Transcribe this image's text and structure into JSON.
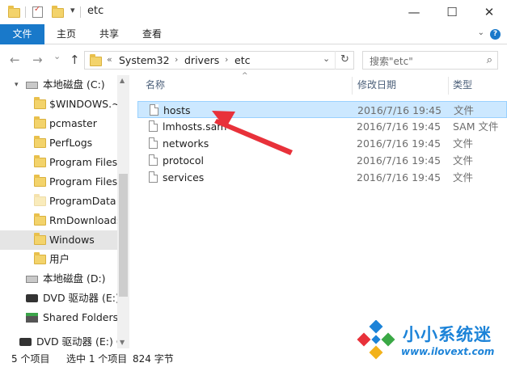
{
  "window": {
    "title": "etc",
    "minimize": "—",
    "maximize": "☐",
    "close": "✕",
    "qa_dropdown": "▾"
  },
  "ribbon": {
    "tabs": [
      "文件",
      "主页",
      "共享",
      "查看"
    ],
    "collapse": "⌄",
    "help": "?"
  },
  "nav_buttons": {
    "back": "←",
    "forward": "→",
    "recent": "⌄",
    "up": "↑"
  },
  "address": {
    "overflow": "«",
    "crumbs": [
      "System32",
      "drivers",
      "etc"
    ],
    "sep": "›",
    "dropdown": "⌄",
    "refresh": "↻"
  },
  "search": {
    "placeholder": "搜索\"etc\"",
    "icon": "⌕"
  },
  "nav_pane": {
    "items": [
      {
        "label": "本地磁盘 (C:)",
        "icon": "drive-icon",
        "kind": "drive"
      },
      {
        "label": "$WINDOWS.~",
        "icon": "folder-icon",
        "kind": "folder"
      },
      {
        "label": "pcmaster",
        "icon": "folder-icon",
        "kind": "folder"
      },
      {
        "label": "PerfLogs",
        "icon": "folder-icon",
        "kind": "folder"
      },
      {
        "label": "Program Files",
        "icon": "folder-icon",
        "kind": "folder"
      },
      {
        "label": "Program Files",
        "icon": "folder-icon",
        "kind": "folder"
      },
      {
        "label": "ProgramData",
        "icon": "folder-icon",
        "kind": "folder"
      },
      {
        "label": "RmDownloads",
        "icon": "folder-icon",
        "kind": "folder"
      },
      {
        "label": "Windows",
        "icon": "folder-icon",
        "kind": "folder",
        "selected": true
      },
      {
        "label": "用户",
        "icon": "folder-icon",
        "kind": "folder"
      },
      {
        "label": "本地磁盘 (D:)",
        "icon": "drive-icon",
        "kind": "drive"
      },
      {
        "label": "DVD 驱动器 (E:)",
        "icon": "dvd-icon",
        "kind": "dvd"
      },
      {
        "label": "Shared Folders",
        "icon": "share-icon",
        "kind": "share"
      },
      {
        "label": "DVD 驱动器 (E:) C",
        "icon": "dvd-icon",
        "kind": "dvd"
      }
    ]
  },
  "file_list": {
    "columns": [
      "名称",
      "修改日期",
      "类型"
    ],
    "sort_indicator": "^",
    "rows": [
      {
        "name": "hosts",
        "date": "2016/7/16 19:45",
        "type": "文件",
        "selected": true
      },
      {
        "name": "lmhosts.sam",
        "date": "2016/7/16 19:45",
        "type": "SAM 文件"
      },
      {
        "name": "networks",
        "date": "2016/7/16 19:45",
        "type": "文件"
      },
      {
        "name": "protocol",
        "date": "2016/7/16 19:45",
        "type": "文件"
      },
      {
        "name": "services",
        "date": "2016/7/16 19:45",
        "type": "文件"
      }
    ]
  },
  "status_bar": {
    "count": "5 个项目",
    "selected": "选中 1 个项目",
    "size": "824 字节"
  },
  "watermark": {
    "title": "小小系统迷",
    "url": "www.ilovext.com"
  },
  "colors": {
    "accent": "#1979ca",
    "selection": "#cce8ff",
    "arrow": "#e8313a",
    "watermark": "#1c83d8"
  }
}
